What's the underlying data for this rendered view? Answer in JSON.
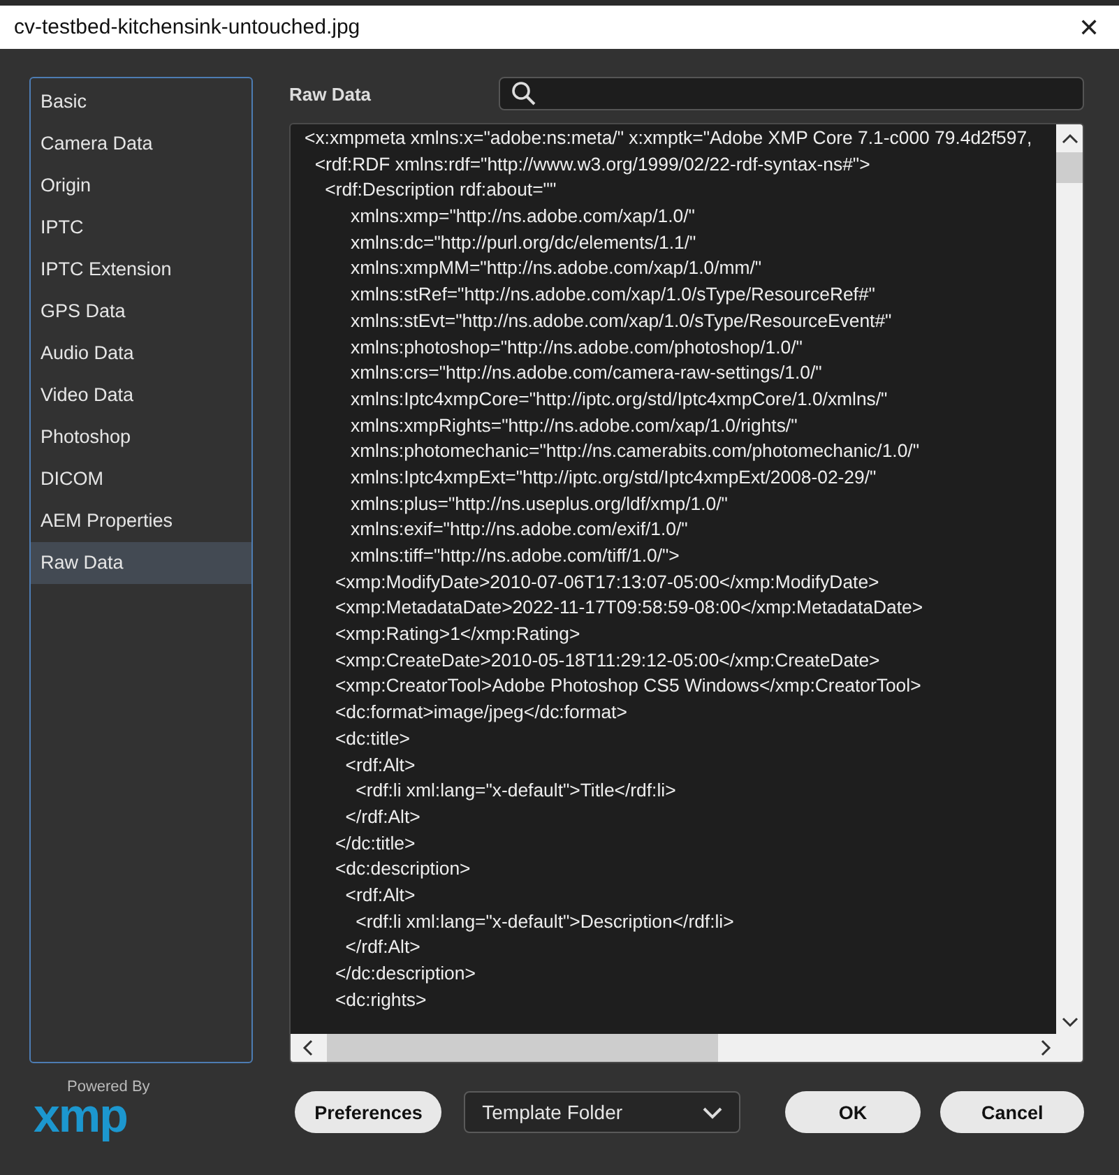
{
  "window": {
    "title": "cv-testbed-kitchensink-untouched.jpg",
    "close": "✕"
  },
  "sidebar": {
    "items": [
      {
        "label": "Basic",
        "selected": false
      },
      {
        "label": "Camera Data",
        "selected": false
      },
      {
        "label": "Origin",
        "selected": false
      },
      {
        "label": "IPTC",
        "selected": false
      },
      {
        "label": "IPTC Extension",
        "selected": false
      },
      {
        "label": "GPS Data",
        "selected": false
      },
      {
        "label": "Audio Data",
        "selected": false
      },
      {
        "label": "Video Data",
        "selected": false
      },
      {
        "label": "Photoshop",
        "selected": false
      },
      {
        "label": "DICOM",
        "selected": false
      },
      {
        "label": "AEM Properties",
        "selected": false
      },
      {
        "label": "Raw Data",
        "selected": true
      }
    ]
  },
  "panel": {
    "title": "Raw Data",
    "lines": [
      "<x:xmpmeta xmlns:x=\"adobe:ns:meta/\" x:xmptk=\"Adobe XMP Core 7.1-c000 79.4d2f597,",
      "  <rdf:RDF xmlns:rdf=\"http://www.w3.org/1999/02/22-rdf-syntax-ns#\">",
      "    <rdf:Description rdf:about=\"\"",
      "         xmlns:xmp=\"http://ns.adobe.com/xap/1.0/\"",
      "         xmlns:dc=\"http://purl.org/dc/elements/1.1/\"",
      "         xmlns:xmpMM=\"http://ns.adobe.com/xap/1.0/mm/\"",
      "         xmlns:stRef=\"http://ns.adobe.com/xap/1.0/sType/ResourceRef#\"",
      "         xmlns:stEvt=\"http://ns.adobe.com/xap/1.0/sType/ResourceEvent#\"",
      "         xmlns:photoshop=\"http://ns.adobe.com/photoshop/1.0/\"",
      "         xmlns:crs=\"http://ns.adobe.com/camera-raw-settings/1.0/\"",
      "         xmlns:Iptc4xmpCore=\"http://iptc.org/std/Iptc4xmpCore/1.0/xmlns/\"",
      "         xmlns:xmpRights=\"http://ns.adobe.com/xap/1.0/rights/\"",
      "         xmlns:photomechanic=\"http://ns.camerabits.com/photomechanic/1.0/\"",
      "         xmlns:Iptc4xmpExt=\"http://iptc.org/std/Iptc4xmpExt/2008-02-29/\"",
      "         xmlns:plus=\"http://ns.useplus.org/ldf/xmp/1.0/\"",
      "         xmlns:exif=\"http://ns.adobe.com/exif/1.0/\"",
      "         xmlns:tiff=\"http://ns.adobe.com/tiff/1.0/\">",
      "      <xmp:ModifyDate>2010-07-06T17:13:07-05:00</xmp:ModifyDate>",
      "      <xmp:MetadataDate>2022-11-17T09:58:59-08:00</xmp:MetadataDate>",
      "      <xmp:Rating>1</xmp:Rating>",
      "      <xmp:CreateDate>2010-05-18T11:29:12-05:00</xmp:CreateDate>",
      "      <xmp:CreatorTool>Adobe Photoshop CS5 Windows</xmp:CreatorTool>",
      "      <dc:format>image/jpeg</dc:format>",
      "      <dc:title>",
      "        <rdf:Alt>",
      "          <rdf:li xml:lang=\"x-default\">Title</rdf:li>",
      "        </rdf:Alt>",
      "      </dc:title>",
      "      <dc:description>",
      "        <rdf:Alt>",
      "          <rdf:li xml:lang=\"x-default\">Description</rdf:li>",
      "        </rdf:Alt>",
      "      </dc:description>",
      "      <dc:rights>"
    ]
  },
  "footer": {
    "logo_caption": "Powered By",
    "logo": "xmp",
    "preferences": "Preferences",
    "template": "Template Folder",
    "ok": "OK",
    "cancel": "Cancel"
  }
}
